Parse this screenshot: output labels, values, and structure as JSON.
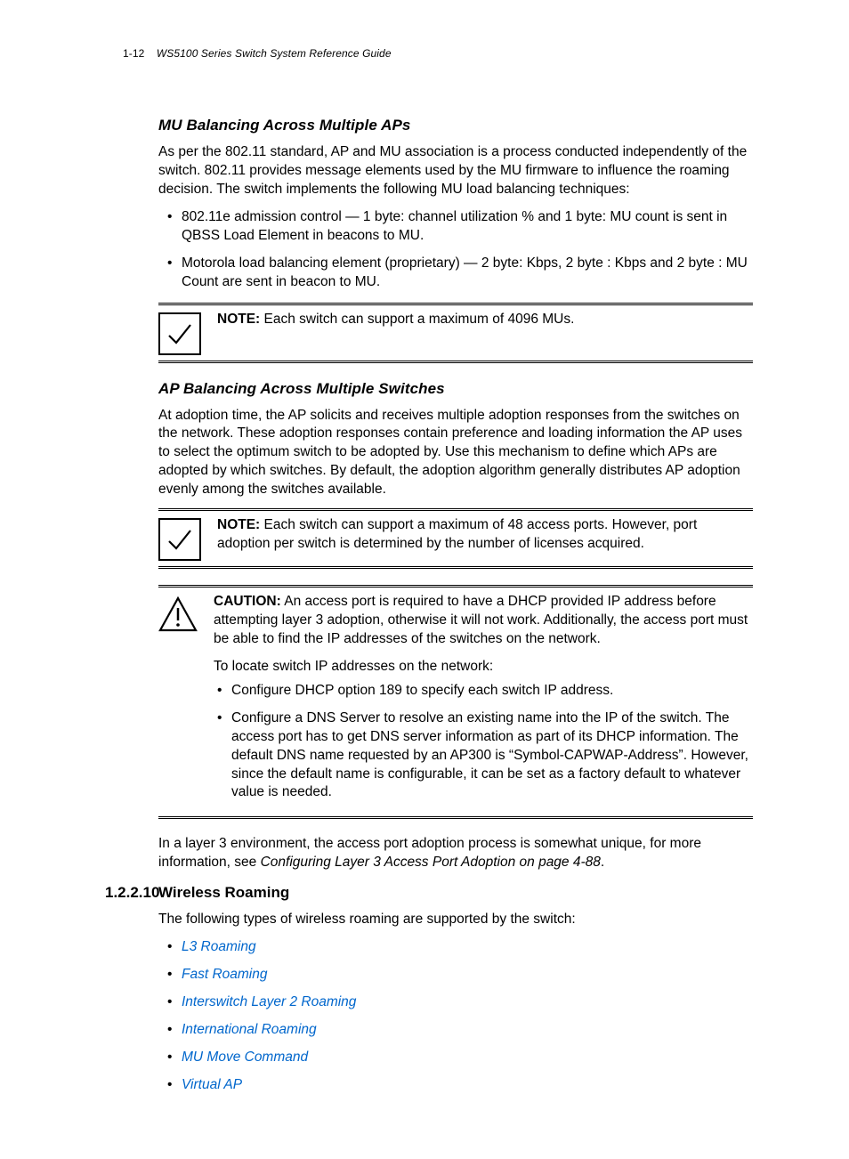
{
  "header": {
    "page_number": "1-12",
    "doc_title": "WS5100 Series Switch System Reference Guide"
  },
  "section_mu": {
    "heading": "MU Balancing Across Multiple APs",
    "para": "As per the 802.11 standard, AP and MU association is a process conducted independently of the switch. 802.11 provides message elements used by the MU firmware to influence the roaming decision. The switch implements the following MU load balancing techniques:",
    "bullets": [
      "802.11e admission control — 1 byte: channel utilization % and 1 byte: MU count is sent in QBSS Load Element in beacons to MU.",
      "Motorola load balancing element (proprietary) — 2 byte: Kbps, 2 byte : Kbps and 2 byte : MU Count are sent in beacon to MU."
    ],
    "note_label": "NOTE:",
    "note_text": " Each switch can support a maximum of 4096 MUs."
  },
  "section_ap": {
    "heading": "AP Balancing Across Multiple Switches",
    "para": "At adoption time, the AP solicits and receives multiple adoption responses from the switches on the network. These adoption responses contain preference and loading information the AP uses to select the optimum switch to be adopted by. Use this mechanism to define which APs are adopted by which switches. By default, the adoption algorithm generally distributes AP adoption evenly among the switches available.",
    "note_label": "NOTE:",
    "note_text": " Each switch can support a maximum of 48 access ports. However, port adoption per switch is determined by the number of licenses acquired.",
    "caution_label": "CAUTION:",
    "caution_text": " An access port is required to have a DHCP provided IP address before attempting layer 3 adoption, otherwise it will not work. Additionally, the access port must be able to find the IP addresses of the switches on the network.",
    "caution_lead": "To locate switch IP addresses on the network:",
    "caution_bullets": [
      "Configure DHCP option 189 to specify each switch IP address.",
      "Configure a DNS Server to resolve an existing name into the IP of the switch. The access port has to get DNS server information as part of its DHCP information. The default DNS name requested by an AP300 is “Symbol-CAPWAP-Address”. However, since the default name is configurable, it can be set as a factory default to whatever value is needed."
    ],
    "trailer_text": " In a layer 3 environment, the access port adoption process is somewhat unique, for more information, see ",
    "trailer_xref": "Configuring Layer 3 Access Port Adoption on page 4-88",
    "trailer_end": "."
  },
  "section_roaming": {
    "number": "1.2.2.10",
    "title": "Wireless Roaming",
    "intro": "The following types of wireless roaming are supported by the switch:",
    "links": [
      "L3 Roaming",
      "Fast Roaming",
      "Interswitch Layer 2 Roaming",
      "International Roaming",
      "MU Move Command",
      "Virtual AP"
    ]
  }
}
